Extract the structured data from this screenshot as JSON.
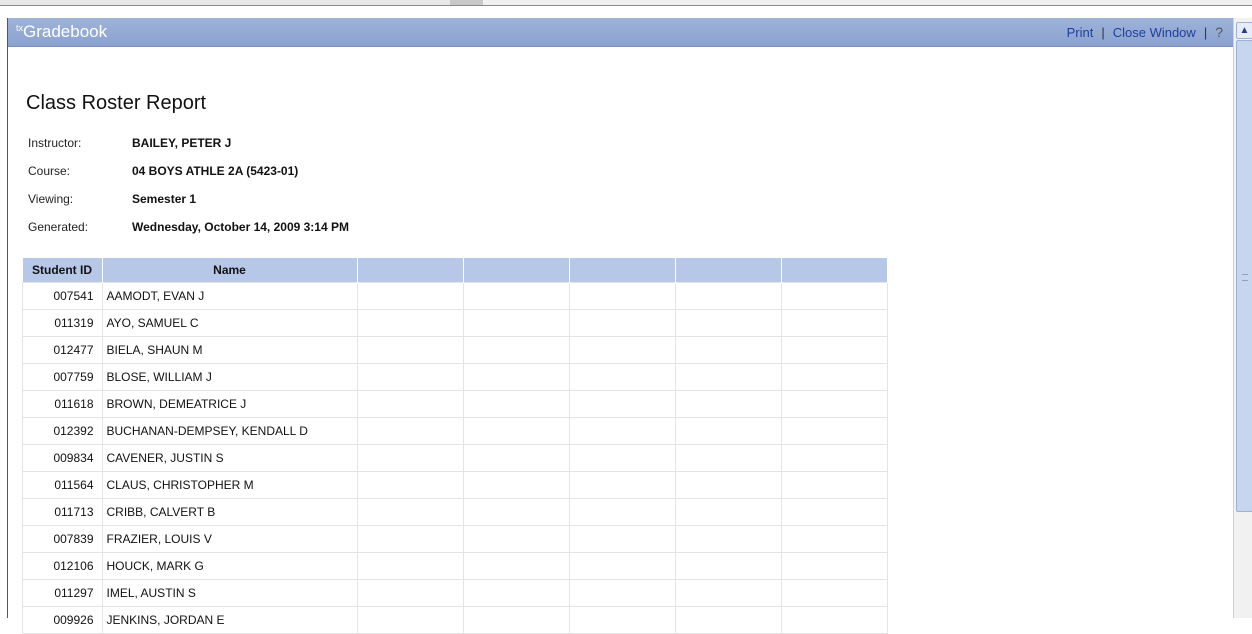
{
  "header": {
    "brand_prefix": "tx",
    "brand": "Gradebook",
    "print_label": "Print",
    "close_label": "Close Window",
    "help_glyph": "?"
  },
  "report": {
    "title": "Class Roster Report",
    "instructor_label": "Instructor:",
    "instructor": "BAILEY, PETER J",
    "course_label": "Course:",
    "course": "04 BOYS ATHLE 2A (5423-01)",
    "viewing_label": "Viewing:",
    "viewing": "Semester 1",
    "generated_label": "Generated:",
    "generated": "Wednesday, October 14, 2009 3:14 PM"
  },
  "table": {
    "col_id": "Student ID",
    "col_name": "Name",
    "rows": [
      {
        "id": "007541",
        "name": "AAMODT, EVAN J"
      },
      {
        "id": "011319",
        "name": "AYO, SAMUEL C"
      },
      {
        "id": "012477",
        "name": "BIELA, SHAUN M"
      },
      {
        "id": "007759",
        "name": "BLOSE, WILLIAM J"
      },
      {
        "id": "011618",
        "name": "BROWN, DEMEATRICE J"
      },
      {
        "id": "012392",
        "name": "BUCHANAN-DEMPSEY, KENDALL D"
      },
      {
        "id": "009834",
        "name": "CAVENER, JUSTIN S"
      },
      {
        "id": "011564",
        "name": "CLAUS, CHRISTOPHER M"
      },
      {
        "id": "011713",
        "name": "CRIBB, CALVERT B"
      },
      {
        "id": "007839",
        "name": "FRAZIER, LOUIS V"
      },
      {
        "id": "012106",
        "name": "HOUCK, MARK G"
      },
      {
        "id": "011297",
        "name": "IMEL, AUSTIN S"
      },
      {
        "id": "009926",
        "name": "JENKINS, JORDAN E"
      }
    ]
  },
  "colors": {
    "header_bg": "#8aa2cf",
    "table_header_bg": "#b7c7e8",
    "link": "#1d3fa0"
  }
}
